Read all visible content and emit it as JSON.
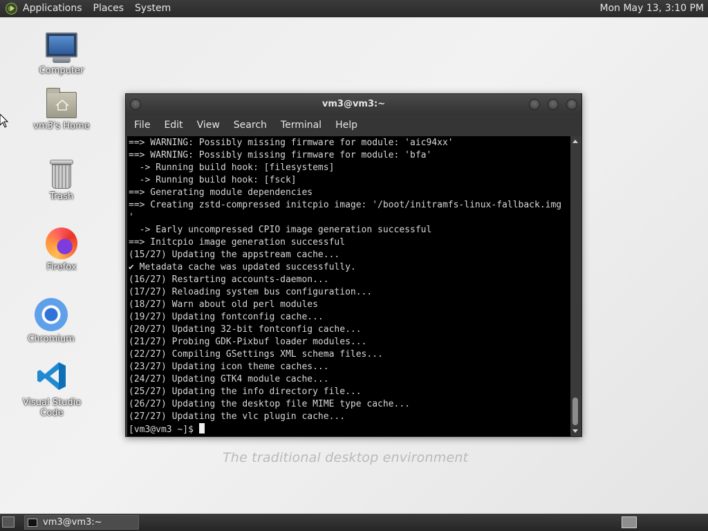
{
  "top_panel": {
    "menus": [
      "Applications",
      "Places",
      "System"
    ],
    "clock": "Mon May 13,  3:10 PM"
  },
  "desktop": {
    "wallpaper_text": "The traditional desktop environment",
    "icons": [
      {
        "label": "Computer",
        "icon": "computer-icon"
      },
      {
        "label": "vm3's Home",
        "icon": "home-folder-icon"
      },
      {
        "label": "Trash",
        "icon": "trash-icon"
      },
      {
        "label": "Firefox",
        "icon": "firefox-icon"
      },
      {
        "label": "Chromium",
        "icon": "chromium-icon"
      },
      {
        "label": "Visual Studio Code",
        "icon": "vscode-icon"
      }
    ]
  },
  "terminal": {
    "title": "vm3@vm3:~",
    "menu": [
      "File",
      "Edit",
      "View",
      "Search",
      "Terminal",
      "Help"
    ],
    "lines": [
      "==> WARNING: Possibly missing firmware for module: 'aic94xx'",
      "==> WARNING: Possibly missing firmware for module: 'bfa'",
      "  -> Running build hook: [filesystems]",
      "  -> Running build hook: [fsck]",
      "==> Generating module dependencies",
      "==> Creating zstd-compressed initcpio image: '/boot/initramfs-linux-fallback.img",
      "'",
      "  -> Early uncompressed CPIO image generation successful",
      "==> Initcpio image generation successful",
      "(15/27) Updating the appstream cache...",
      "✔ Metadata cache was updated successfully.",
      "(16/27) Restarting accounts-daemon...",
      "(17/27) Reloading system bus configuration...",
      "(18/27) Warn about old perl modules",
      "(19/27) Updating fontconfig cache...",
      "(20/27) Updating 32-bit fontconfig cache...",
      "(21/27) Probing GDK-Pixbuf loader modules...",
      "(22/27) Compiling GSettings XML schema files...",
      "(23/27) Updating icon theme caches...",
      "(24/27) Updating GTK4 module cache...",
      "(25/27) Updating the info directory file...",
      "(26/27) Updating the desktop file MIME type cache...",
      "(27/27) Updating the vlc plugin cache..."
    ],
    "prompt": "[vm3@vm3 ~]$ "
  },
  "bottom_panel": {
    "task_label": "vm3@vm3:~"
  }
}
